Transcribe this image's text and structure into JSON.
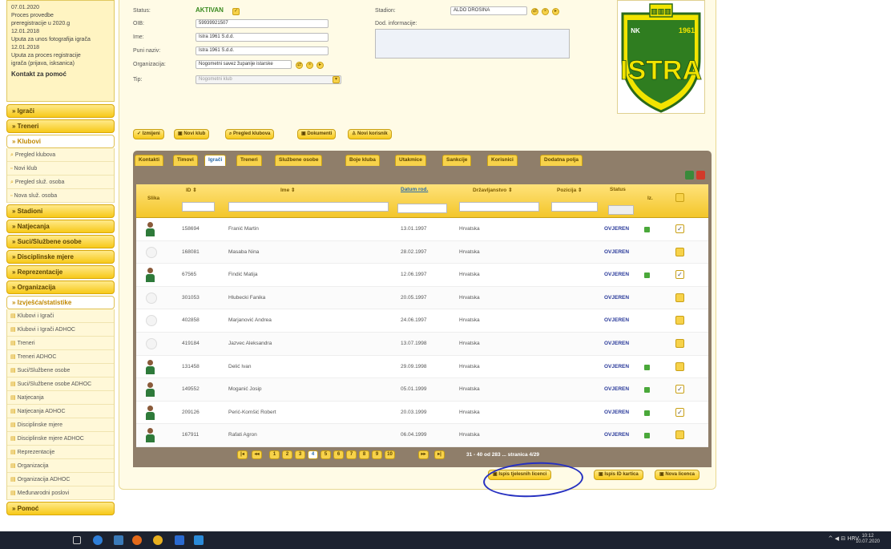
{
  "sidebar": {
    "news": [
      "07.01.2020",
      "Proces provedbe",
      "preregistracije u 2020.g",
      "12.01.2018",
      "Uputa za unos fotografija igrača",
      "12.01.2018",
      "Uputa za proces registracije",
      "igrača (prijava, isksanica)"
    ],
    "help": "Kontakt za pomoć",
    "menu": [
      {
        "label": "» Igrači"
      },
      {
        "label": "» Treneri"
      },
      {
        "label": "» Klubovi",
        "open": true,
        "items": [
          "Pregled klubova",
          "Novi klub"
        ]
      },
      {
        "label": "",
        "items": [
          "Pregled služ. osoba",
          "Nova služ. osoba"
        ]
      },
      {
        "label": "» Stadioni"
      },
      {
        "label": "» Natjecanja"
      },
      {
        "label": "» Suci/Službene osobe"
      },
      {
        "label": "» Disciplinske mjere"
      },
      {
        "label": "» Reprezentacije"
      },
      {
        "label": "» Organizacija"
      },
      {
        "label": "» Izvješća/statistike",
        "open": true,
        "items": [
          "Klubovi i Igrači",
          "Klubovi i Igrači ADHOC",
          "Treneri",
          "Treneri ADHOC",
          "Suci/Službene osobe",
          "Suci/Službene osobe ADHOC",
          "Natjecanja",
          "Natjecanja ADHOC",
          "Disciplinske mjere",
          "Disciplinske mjere ADHOC",
          "Reprezentacije",
          "Organizacija",
          "Organizacija ADHOC",
          "Međunarodni poslovi"
        ]
      },
      {
        "label": "» Pomoć"
      }
    ]
  },
  "club": {
    "status_label": "Status:",
    "status_value": "AKTIVAN",
    "oib_label": "OIB:",
    "oib_value": "59939921507",
    "ime_label": "Ime:",
    "ime_value": "Istra 1961 S.d.d.",
    "puni_label": "Puni naziv:",
    "puni_value": "Istra 1961 S.d.d.",
    "org_label": "Organizacija:",
    "org_value": "Nogometni savez županije istarske",
    "tip_label": "Tip:",
    "tip_value": "Nogometni klub",
    "stadion_label": "Stadion:",
    "stadion_value": "ALDO DROSINA",
    "info_label": "Dod. informacije:",
    "crest_text": "ISTRA",
    "crest_year": "1961",
    "crest_nk": "NK"
  },
  "actions": [
    "✓ Izmijeni",
    "▣ Novi klub",
    "⌕ Pregled klubova",
    "▣ Dokumenti",
    "♙ Novi korisnik"
  ],
  "tabs": [
    "Kontakti",
    "Timovi",
    "Igrači",
    "Treneri",
    "Službene osobe",
    "Boje kluba",
    "Utakmice",
    "Sankcije",
    "Korisnici",
    "Dodatna polja"
  ],
  "active_tab": "Igrači",
  "grid": {
    "headers": {
      "slika": "Slika",
      "id": "ID ⇕",
      "ime": "Ime ⇕",
      "datum": "Datum rod.",
      "drzavljanstvo": "Državljanstvo ⇕",
      "pozicija": "Pozicija ⇕",
      "status": "Status",
      "iz": "Iz."
    },
    "rows": [
      {
        "photo": true,
        "id": "158694",
        "ime": "Franić Martin",
        "datum": "13.01.1997",
        "drz": "Hrvatska",
        "status": "OVJEREN",
        "dot": true,
        "chk": true
      },
      {
        "photo": false,
        "id": "168081",
        "ime": "Masaba Nina",
        "datum": "28.02.1997",
        "drz": "Hrvatska",
        "status": "OVJEREN",
        "dot": false,
        "chk": false
      },
      {
        "photo": true,
        "id": "67565",
        "ime": "Findić Matija",
        "datum": "12.06.1997",
        "drz": "Hrvatska",
        "status": "OVJEREN",
        "dot": true,
        "chk": true
      },
      {
        "photo": false,
        "id": "301053",
        "ime": "Hlubecki Fanika",
        "datum": "20.05.1997",
        "drz": "Hrvatska",
        "status": "OVJEREN",
        "dot": false,
        "chk": false
      },
      {
        "photo": false,
        "id": "402858",
        "ime": "Marjanović Andrea",
        "datum": "24.06.1997",
        "drz": "Hrvatska",
        "status": "OVJEREN",
        "dot": false,
        "chk": false
      },
      {
        "photo": false,
        "id": "419184",
        "ime": "Jazvec Aleksandra",
        "datum": "13.07.1998",
        "drz": "Hrvatska",
        "status": "OVJEREN",
        "dot": false,
        "chk": false
      },
      {
        "photo": true,
        "id": "131458",
        "ime": "Delić Ivan",
        "datum": "29.09.1998",
        "drz": "Hrvatska",
        "status": "OVJEREN",
        "dot": true,
        "chk": false
      },
      {
        "photo": true,
        "id": "149552",
        "ime": "Moganić Josip",
        "datum": "05.01.1999",
        "drz": "Hrvatska",
        "status": "OVJEREN",
        "dot": true,
        "chk": true
      },
      {
        "photo": true,
        "id": "209126",
        "ime": "Perić-Komšić Robert",
        "datum": "20.03.1999",
        "drz": "Hrvatska",
        "status": "OVJEREN",
        "dot": true,
        "chk": true
      },
      {
        "photo": true,
        "id": "167911",
        "ime": "Rafati Agron",
        "datum": "06.04.1999",
        "drz": "Hrvatska",
        "status": "OVJEREN",
        "dot": true,
        "chk": false
      }
    ]
  },
  "pager": {
    "pages": [
      "1",
      "2",
      "3",
      "4",
      "5",
      "6",
      "7",
      "8",
      "9",
      "10"
    ],
    "current": "4",
    "first": "|◂",
    "prev": "◂◂",
    "next": "▸▸",
    "last": "▸|",
    "info": "31 - 40 od 283 ... stranica 4/29"
  },
  "bottom_buttons": [
    "▣ Ispis tjelesnih licenci",
    "▣ Ispis ID kartica",
    "▣ Nova licenca"
  ],
  "taskbar": {
    "tray": "^ ◀ ⊟ HRV",
    "time": "10:12",
    "date": "10.07.2020"
  }
}
